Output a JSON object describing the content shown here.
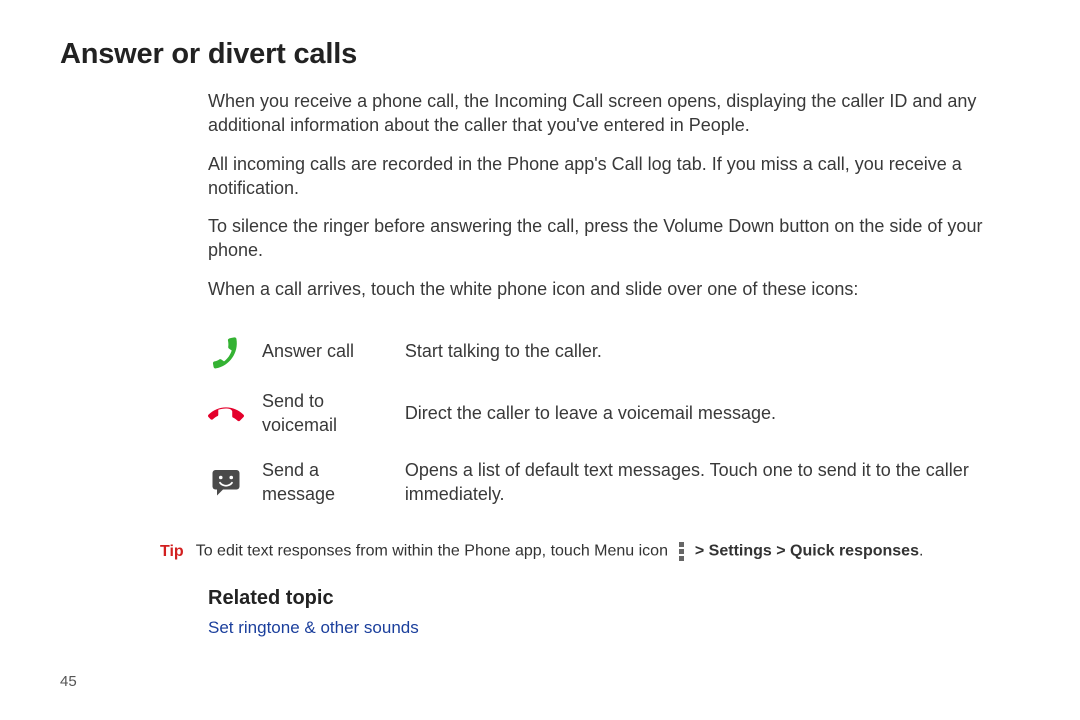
{
  "title": "Answer or divert calls",
  "paragraphs": [
    "When you receive a phone call, the Incoming Call screen opens, displaying the caller ID and any additional information about the caller that you've entered in People.",
    "All incoming calls are recorded in the Phone app's Call log tab. If you miss a call, you receive a notification.",
    "To silence the ringer before answering the call, press the Volume Down button on the side of your phone.",
    "When a call arrives, touch the white phone icon and slide over one of these icons:"
  ],
  "actions": [
    {
      "icon": "phone-answer-icon",
      "label": "Answer call",
      "desc": "Start talking to the caller."
    },
    {
      "icon": "phone-hangup-icon",
      "label": "Send to voicemail",
      "desc": "Direct the caller to leave a voicemail message."
    },
    {
      "icon": "message-icon",
      "label": "Send a message",
      "desc": "Opens a list of default text messages. Touch one to send it to the caller immediately."
    }
  ],
  "tip": {
    "label": "Tip",
    "pre": "To edit text responses from within the Phone app, touch Menu icon",
    "bold": " > Settings > Quick responses",
    "post": "."
  },
  "related": {
    "heading": "Related topic",
    "link": "Set ringtone & other sounds"
  },
  "page_number": "45"
}
